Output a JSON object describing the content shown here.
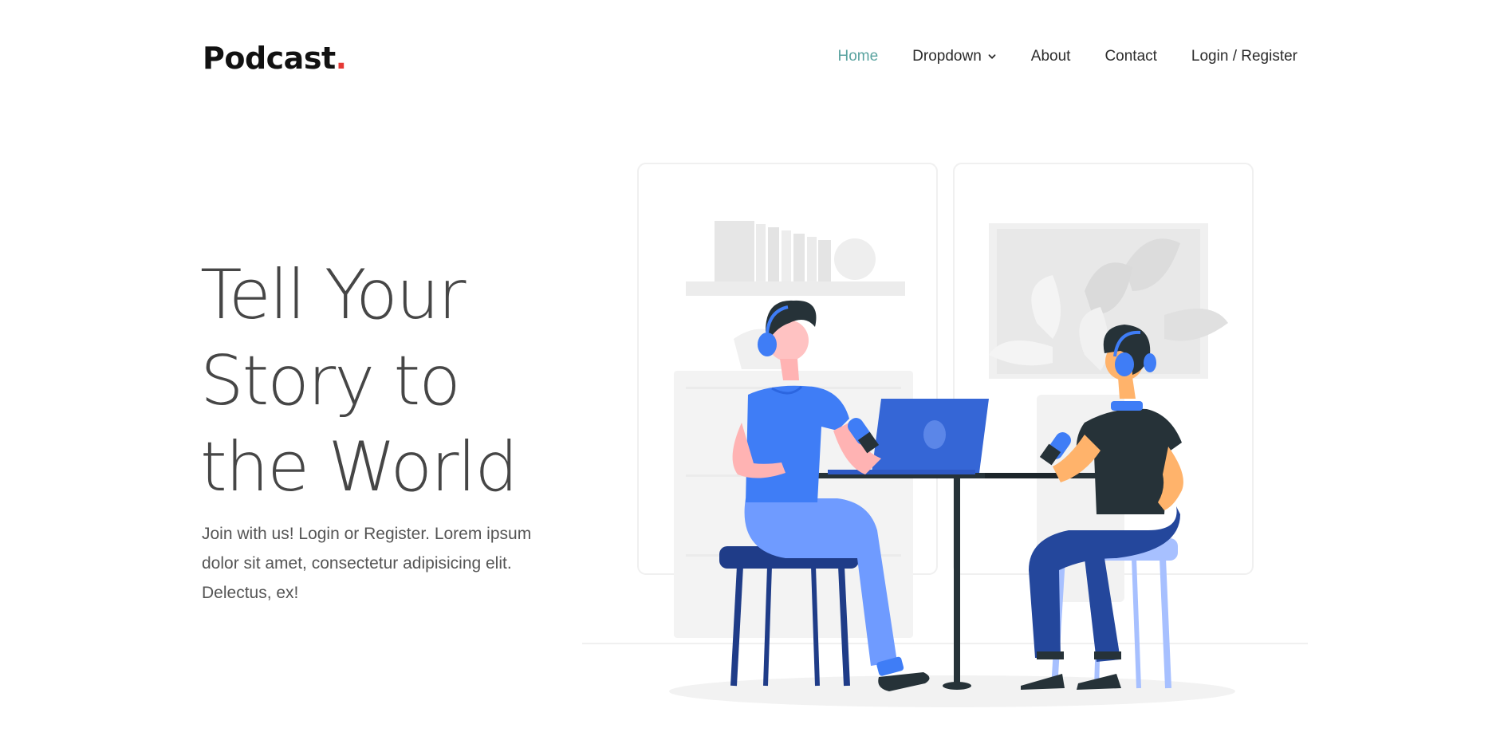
{
  "brand": {
    "name": "Podcast",
    "dot": "."
  },
  "nav": {
    "items": [
      {
        "label": "Home",
        "active": true
      },
      {
        "label": "Dropdown",
        "has_dropdown": true
      },
      {
        "label": "About"
      },
      {
        "label": "Contact"
      },
      {
        "label": "Login / Register"
      }
    ]
  },
  "hero": {
    "title_lines": [
      "Tell Your",
      "Story to",
      "the World"
    ],
    "description": "Join with us! Login or Register. Lorem ipsum dolor sit amet, consectetur adipisicing elit. Delectus, ex!"
  },
  "colors": {
    "accent_nav": "#5aa3a0",
    "brand_dot": "#e53935",
    "illustration_blue": "#3f7df6",
    "illustration_dark": "#263238"
  },
  "icons": {
    "dropdown": "chevron-down-icon"
  }
}
